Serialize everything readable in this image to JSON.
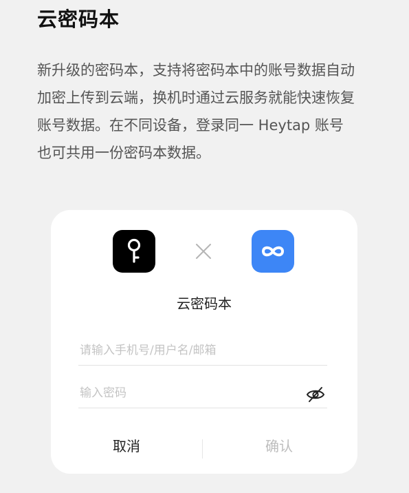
{
  "page": {
    "title": "云密码本",
    "description_lines": [
      "新升级的密码本，支持将密码本中的账号数据自动",
      "加密上传到云端，换机时通过云服务就能快速恢复",
      "账号数据。在不同设备，登录同一 Heytap 账号",
      "也可共用一份密码本数据。"
    ]
  },
  "dialog": {
    "icons": {
      "left": "key-app-icon",
      "middle": "times-icon",
      "right": "infinity-cloud-app-icon"
    },
    "title": "云密码本",
    "username_field": {
      "placeholder": "请输入手机号/用户名/邮箱",
      "value": ""
    },
    "password_field": {
      "placeholder": "输入密码",
      "value": "",
      "visibility_icon": "eye-off-icon"
    },
    "cancel_label": "取消",
    "confirm_label": "确认"
  },
  "colors": {
    "background": "#f1f1f1",
    "card": "#ffffff",
    "cloud_icon": "#3d86f6",
    "key_icon": "#000000",
    "disabled_text": "#bdbdbd"
  }
}
